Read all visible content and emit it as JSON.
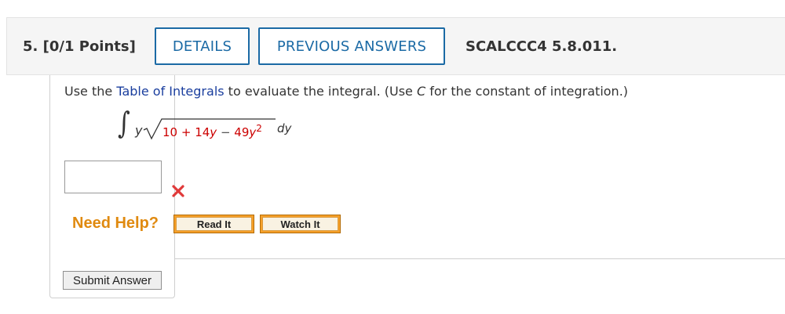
{
  "question": {
    "number_points": "5.  [0/1 Points]",
    "details_label": "DETAILS",
    "previous_answers_label": "PREVIOUS ANSWERS",
    "code": "SCALCCC4 5.8.011."
  },
  "instructions": {
    "before": "Use the ",
    "link": "Table of Integrals",
    "middle": " to evaluate the integral. (Use ",
    "constant": "C",
    "after": " for the constant of integration.)"
  },
  "formula": {
    "integral_sign": "∫",
    "factor": "y",
    "radicand_part1": "10 + 14",
    "radicand_var1": "y",
    "radicand_minus": " − ",
    "radicand_part2": "49",
    "radicand_var2": "y",
    "radicand_exp": "2",
    "differential": "dy"
  },
  "answer": {
    "value": "",
    "status": "incorrect"
  },
  "help": {
    "label": "Need Help?",
    "read_label": "Read It",
    "watch_label": "Watch It"
  },
  "submit_label": "Submit Answer",
  "colors": {
    "header_bg": "#f5f5f5",
    "button_blue": "#1b6aa5",
    "link_blue": "#1a3e9e",
    "radicand_red": "#cc0000",
    "incorrect_red": "#e03a3a",
    "help_orange": "#e08a10"
  }
}
